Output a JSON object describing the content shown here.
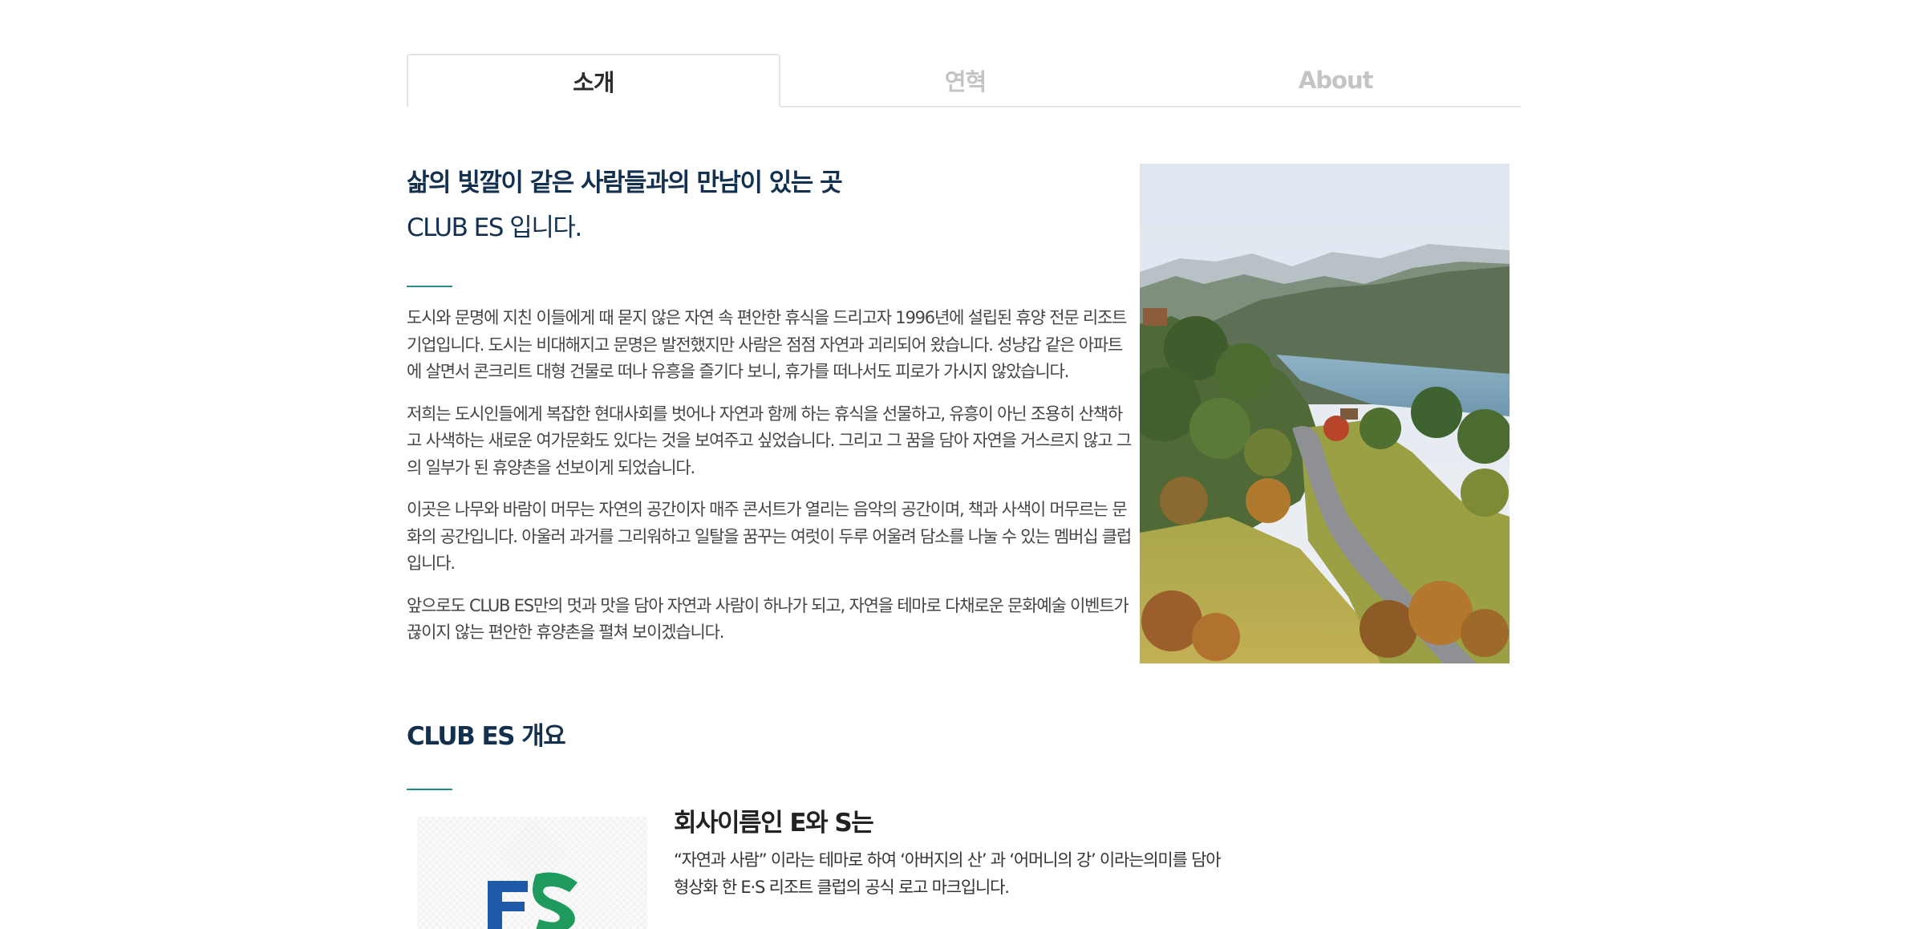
{
  "tabs": [
    {
      "label": "소개",
      "active": true
    },
    {
      "label": "연혁",
      "active": false
    },
    {
      "label": "About",
      "active": false
    }
  ],
  "intro": {
    "headline": "삶의 빛깔이 같은 사람들과의 만남이 있는 곳",
    "subline": "CLUB ES 입니다.",
    "paragraphs": [
      "도시와 문명에 지친 이들에게 때 묻지 않은 자연 속 편안한 휴식을 드리고자 1996년에 설립된 휴양 전문 리조트 기업입니다. 도시는 비대해지고 문명은 발전했지만 사람은 점점 자연과 괴리되어 왔습니다. 성냥갑 같은 아파트에 살면서 콘크리트 대형 건물로 떠나 유흥을 즐기다 보니, 휴가를 떠나서도 피로가 가시지 않았습니다.",
      "저희는 도시인들에게 복잡한 현대사회를 벗어나 자연과 함께 하는 휴식을 선물하고, 유흥이 아닌 조용히 산책하고 사색하는 새로운 여가문화도 있다는 것을 보여주고 싶었습니다. 그리고 그 꿈을 담아 자연을 거스르지 않고 그의 일부가 된 휴양촌을 선보이게 되었습니다.",
      "이곳은 나무와 바람이 머무는 자연의 공간이자 매주 콘서트가 열리는 음악의 공간이며, 책과 사색이 머무르는 문화의 공간입니다. 아울러 과거를 그리워하고 일탈을 꿈꾸는 여럿이 두루 어울려 담소를 나눌 수 있는 멤버십 클럽입니다.",
      "앞으로도 CLUB ES만의 멋과 맛을 담아 자연과 사람이 하나가 되고, 자연을 테마로 다채로운 문화예술 이벤트가 끊이지 않는 편안한 휴양촌을 펼쳐 보이겠습니다."
    ],
    "photo": "mountain-lake-resort-photo"
  },
  "overview": {
    "title": "CLUB ES 개요",
    "company_title": "회사이름인 E와 S는",
    "company_desc_line1": "“자연과 사람” 이라는 테마로 하여 ‘아버지의 산’ 과 ‘어머니의 강’ 이라는의미를 담아",
    "company_desc_line2": "형상화 한 E·S 리조트 클럽의 공식 로고 마크입니다."
  },
  "colors": {
    "heading": "#14304f",
    "accent": "#2a8c8f",
    "logo_blue": "#1e5aa8",
    "logo_green": "#1d9a5c",
    "tab_inactive": "#c4c4c4"
  }
}
